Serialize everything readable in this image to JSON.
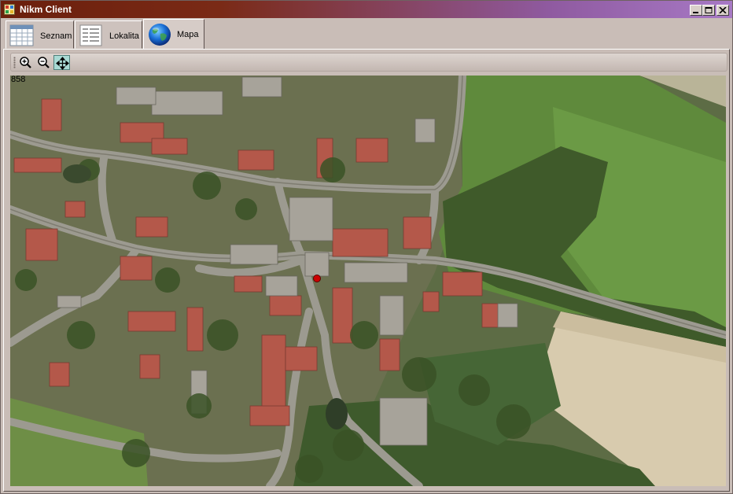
{
  "window": {
    "title": "Nikm Client"
  },
  "tabs": [
    {
      "label": "Seznam",
      "icon": "table-icon",
      "active": false
    },
    {
      "label": "Lokalita",
      "icon": "form-icon",
      "active": false
    },
    {
      "label": "Mapa",
      "icon": "globe-icon",
      "active": true
    }
  ],
  "toolbar": {
    "buttons": [
      {
        "name": "zoom-in",
        "icon": "zoom-in-icon",
        "pressed": false
      },
      {
        "name": "zoom-out",
        "icon": "zoom-out-icon",
        "pressed": false
      },
      {
        "name": "pan",
        "icon": "pan-icon",
        "pressed": true
      }
    ]
  },
  "map": {
    "scale_readout": "858",
    "marker_color": "#cc0000"
  },
  "colors": {
    "title_gradient_start": "#6b1f0c",
    "title_gradient_end": "#a779c5",
    "window_bg": "#c9bdb7",
    "pressed_button": "#a9dad4"
  }
}
